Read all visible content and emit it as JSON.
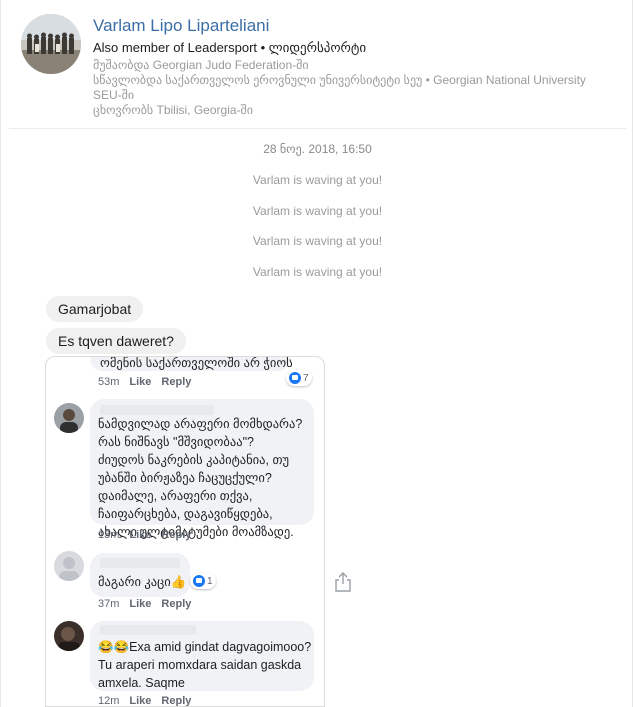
{
  "profile": {
    "name": "Varlam Lipo Liparteliani",
    "member": "Also member of Leadersport • ლიდერსპორტი",
    "work": "მუშაობდა Georgian Judo Federation-ში",
    "education": "სწავლობდა საქართველოს ეროვნული უნივერსიტეტი სეუ • Georgian National University SEU-ში",
    "city": "ცხოვრობს Tbilisi, Georgia-ში"
  },
  "conversation": {
    "timestamp": "28 ნოე. 2018, 16:50",
    "waves": [
      "Varlam is waving at you!",
      "Varlam is waving at you!",
      "Varlam is waving at you!",
      "Varlam is waving at you!"
    ],
    "messages": [
      "Gamarjobat",
      "Es tqven daweret?"
    ]
  },
  "shared_screenshot": {
    "comments": [
      {
        "text": "ომენის საქართველოში არ ჭიოს",
        "time": "53m",
        "like": "Like",
        "reply": "Reply",
        "reactions": "7"
      },
      {
        "text": "ნამდვილად არაფერი მომხდარა?\nრას ნიშნავს \"მშვიდობაა\"?\nძიუდოს ნაკრების კაპიტანია, თუ\nუბანში ბირჟაზეა ჩაცუცქული?\nდაიმალე, არაფერი თქვა,\nჩაიფარცხება, დაგავიწყდება,\nახალი ულტიმატუმები მოამზადე.",
        "time": "13m",
        "like": "Like",
        "reply": "Reply"
      },
      {
        "text": "მაგარი კაცი👍",
        "time": "37m",
        "like": "Like",
        "reply": "Reply",
        "reactions": "1"
      },
      {
        "text": "😂😂Exa amid gindat dagvagoimooo?\nTu araperi  momxdara saidan gaskda\namxela. Saqme",
        "time": "12m",
        "like": "Like",
        "reply": "Reply"
      }
    ]
  },
  "icons": {
    "share": "share-icon",
    "like_reaction": "like-reaction-icon"
  },
  "colors": {
    "name_link": "#3b6ea5",
    "bubble": "#f1f0f0",
    "fb_blue": "#1877f2"
  }
}
